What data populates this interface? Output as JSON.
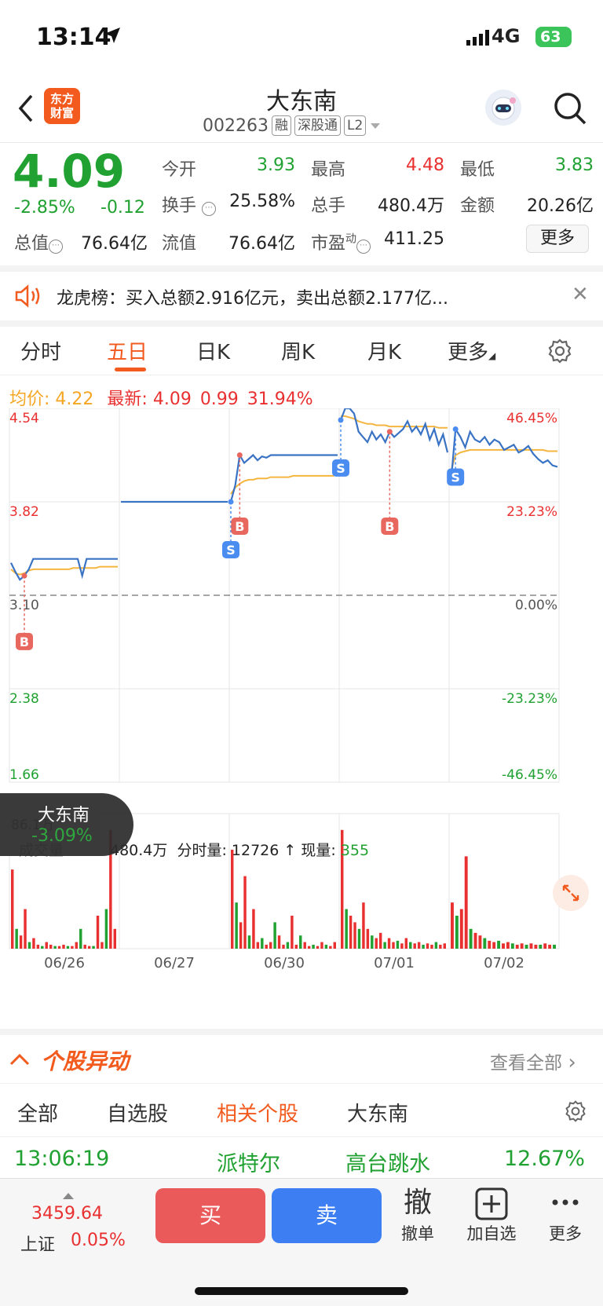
{
  "status": {
    "time": "13:14",
    "network": "4G",
    "battery": "63"
  },
  "header": {
    "logo_line1": "东方",
    "logo_line2": "财富",
    "stock_name": "大东南",
    "stock_code": "002263",
    "tags": [
      "融",
      "深股通",
      "L2"
    ]
  },
  "quote": {
    "price": "4.09",
    "change_pct": "-2.85%",
    "change_amt": "-0.12",
    "open_label": "今开",
    "open": "3.93",
    "high_label": "最高",
    "high": "4.48",
    "low_label": "最低",
    "low": "3.83",
    "turnover_label": "换手",
    "turnover": "25.58%",
    "volume_label": "总手",
    "volume": "480.4万",
    "amount_label": "金额",
    "amount": "20.26亿",
    "mktcap_label": "总值",
    "mktcap": "76.64亿",
    "float_label": "流值",
    "float": "76.64亿",
    "pe_label": "市盈",
    "pe_sup": "动",
    "pe": "411.25",
    "more": "更多"
  },
  "dragon": {
    "text": "龙虎榜：买入总额2.916亿元，卖出总额2.177亿..."
  },
  "tabs": [
    "分时",
    "五日",
    "日K",
    "周K",
    "月K",
    "更多"
  ],
  "chart_header": {
    "avg_label": "均价:",
    "avg": "4.22",
    "latest_label": "最新:",
    "latest": "4.09",
    "latest_chg": "0.99",
    "latest_pct": "31.94%"
  },
  "chart_data": {
    "type": "line",
    "y_left_ticks": [
      "4.54",
      "3.82",
      "3.10",
      "2.38",
      "1.66"
    ],
    "y_right_ticks": [
      "46.45%",
      "23.23%",
      "0.00%",
      "-23.23%",
      "-46.45%"
    ],
    "x_labels": [
      "06/26",
      "06/27",
      "06/30",
      "07/01",
      "07/02"
    ],
    "ylim": [
      1.66,
      4.54
    ],
    "prev_close": 3.1,
    "days": [
      {
        "price": [
          3.35,
          3.28,
          3.22,
          3.25,
          3.3,
          3.38,
          3.38,
          3.38,
          3.38,
          3.38,
          3.38,
          3.38,
          3.38,
          3.38,
          3.38,
          3.38,
          3.25,
          3.38,
          3.38,
          3.38,
          3.38,
          3.38,
          3.38,
          3.38,
          3.38
        ],
        "avg": [
          3.3,
          3.27,
          3.26,
          3.27,
          3.29,
          3.3,
          3.3,
          3.3,
          3.3,
          3.3,
          3.3,
          3.3,
          3.3,
          3.3,
          3.31,
          3.31,
          3.31,
          3.31,
          3.31,
          3.31,
          3.32,
          3.32,
          3.32,
          3.32,
          3.32
        ]
      },
      {
        "price": [
          3.82,
          3.82,
          3.82,
          3.82,
          3.82,
          3.82,
          3.82,
          3.82,
          3.82,
          3.82,
          3.82,
          3.82,
          3.82,
          3.82,
          3.82,
          3.82,
          3.82,
          3.82,
          3.82,
          3.82,
          3.82,
          3.82,
          3.82,
          3.82,
          3.82
        ],
        "avg": [
          3.82,
          3.82,
          3.82,
          3.82,
          3.82,
          3.82,
          3.82,
          3.82,
          3.82,
          3.82,
          3.82,
          3.82,
          3.82,
          3.82,
          3.82,
          3.82,
          3.82,
          3.82,
          3.82,
          3.82,
          3.82,
          3.82,
          3.82,
          3.82,
          3.82
        ]
      },
      {
        "price": [
          3.82,
          3.95,
          4.18,
          4.12,
          4.15,
          4.18,
          4.14,
          4.17,
          4.16,
          4.18,
          4.18,
          4.18,
          4.18,
          4.18,
          4.18,
          4.18,
          4.18,
          4.18,
          4.18,
          4.18,
          4.18,
          4.18,
          4.18,
          4.18,
          4.18
        ],
        "avg": [
          3.88,
          3.93,
          3.96,
          3.98,
          3.99,
          3.99,
          4.0,
          4.0,
          4.0,
          4.01,
          4.01,
          4.01,
          4.01,
          4.01,
          4.02,
          4.02,
          4.02,
          4.02,
          4.02,
          4.02,
          4.02,
          4.02,
          4.02,
          4.02,
          4.03
        ]
      },
      {
        "price": [
          4.45,
          4.54,
          4.54,
          4.5,
          4.36,
          4.32,
          4.28,
          4.36,
          4.3,
          4.34,
          4.28,
          4.36,
          4.32,
          4.35,
          4.38,
          4.44,
          4.36,
          4.4,
          4.34,
          4.42,
          4.3,
          4.38,
          4.26,
          4.34,
          4.2
        ],
        "avg": [
          4.48,
          4.48,
          4.47,
          4.46,
          4.44,
          4.43,
          4.42,
          4.42,
          4.41,
          4.41,
          4.41,
          4.4,
          4.4,
          4.4,
          4.4,
          4.4,
          4.4,
          4.4,
          4.4,
          4.4,
          4.4,
          4.4,
          4.39,
          4.39,
          4.39
        ]
      },
      {
        "price": [
          3.95,
          4.38,
          4.32,
          4.24,
          4.36,
          4.3,
          4.28,
          4.32,
          4.26,
          4.3,
          4.28,
          4.22,
          4.24,
          4.26,
          4.2,
          4.22,
          4.25,
          4.19,
          4.15,
          4.12,
          4.14,
          4.1,
          4.09
        ],
        "avg": [
          4.05,
          4.18,
          4.2,
          4.21,
          4.22,
          4.22,
          4.22,
          4.22,
          4.22,
          4.22,
          4.22,
          4.22,
          4.22,
          4.22,
          4.22,
          4.22,
          4.22,
          4.22,
          4.22,
          4.22,
          4.21,
          4.21,
          4.21
        ]
      }
    ],
    "markers": [
      {
        "type": "B",
        "day": 0,
        "idx": 3
      },
      {
        "type": "S",
        "day": 2,
        "idx": 0
      },
      {
        "type": "B",
        "day": 2,
        "idx": 2
      },
      {
        "type": "S",
        "day": 3,
        "idx": 0
      },
      {
        "type": "B",
        "day": 3,
        "idx": 11
      },
      {
        "type": "S",
        "day": 4,
        "idx": 1
      }
    ],
    "volume_max_label": "86.1万",
    "volume_label": "成交量",
    "volume_total": "480.4万",
    "volume_line_label": "分时量:",
    "volume_line_value": "12726",
    "volume_now_label": "现量:",
    "volume_now_value": "355",
    "volume": [
      [
        0.6,
        0.15,
        0.1,
        0.3,
        0.05,
        0.08,
        0.03,
        0.02,
        0.05,
        0.03,
        0.02,
        0.02,
        0.03,
        0.02,
        0.02,
        0.05,
        0.15,
        0.03,
        0.02,
        0.02,
        0.25,
        0.05,
        0.3,
        0.9,
        0.15
      ],
      [
        0.0,
        0.0,
        0.0,
        0.0,
        0.0,
        0.0,
        0.0,
        0.0,
        0.0,
        0.0,
        0.0,
        0.0,
        0.0,
        0.0,
        0.0,
        0.0,
        0.0,
        0.0,
        0.0,
        0.0,
        0.0,
        0.0,
        0.0,
        0.0,
        0.0
      ],
      [
        0.75,
        0.35,
        0.2,
        0.55,
        0.1,
        0.3,
        0.05,
        0.08,
        0.03,
        0.05,
        0.2,
        0.1,
        0.03,
        0.05,
        0.25,
        0.03,
        0.1,
        0.05,
        0.02,
        0.03,
        0.02,
        0.05,
        0.03,
        0.02,
        0.05
      ],
      [
        0.9,
        0.3,
        0.25,
        0.2,
        0.15,
        0.35,
        0.15,
        0.1,
        0.08,
        0.12,
        0.05,
        0.08,
        0.05,
        0.06,
        0.04,
        0.08,
        0.05,
        0.04,
        0.05,
        0.03,
        0.04,
        0.03,
        0.05,
        0.03,
        0.04
      ],
      [
        0.35,
        0.25,
        0.3,
        0.7,
        0.15,
        0.12,
        0.1,
        0.08,
        0.06,
        0.05,
        0.06,
        0.04,
        0.05,
        0.04,
        0.03,
        0.04,
        0.03,
        0.04,
        0.03,
        0.03,
        0.04,
        0.03,
        0.03
      ]
    ]
  },
  "float_tag": {
    "name": "大东南",
    "pct": "-3.09%"
  },
  "movement": {
    "title": "个股异动",
    "view_all": "查看全部",
    "tabs": [
      "全部",
      "自选股",
      "相关个股",
      "大东南"
    ],
    "row": {
      "time": "13:06:19",
      "stock": "派特尔",
      "event": "高台跳水",
      "pct": "12.67%"
    }
  },
  "bottom": {
    "index_value": "3459.64",
    "index_name": "上证",
    "index_pct": "0.05%",
    "buy": "买",
    "sell": "卖",
    "cancel_icon": "撤",
    "cancel": "撤单",
    "add": "加自选",
    "more": "更多"
  },
  "colors": {
    "accent": "#f25a1e",
    "up": "#e93030",
    "down": "#20a131",
    "price_line": "#3a73c4",
    "avg_line": "#f5b640"
  }
}
